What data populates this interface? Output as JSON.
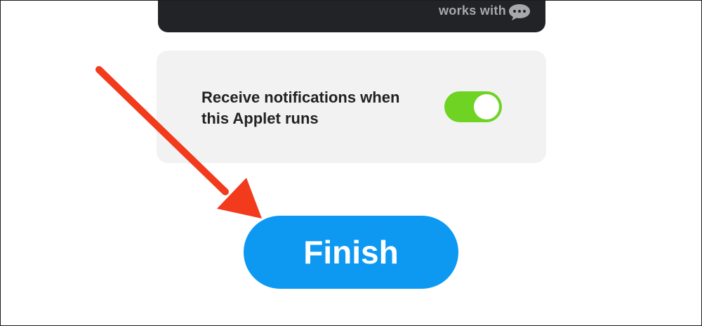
{
  "top_card": {
    "works_with_text": "works with",
    "icon": "chat-bubble-icon"
  },
  "notifications": {
    "label": "Receive notifications when this Applet runs",
    "toggle_on": true
  },
  "finish_button": {
    "label": "Finish"
  },
  "annotation": {
    "icon": "red-arrow-icon",
    "color": "#f23a1d"
  },
  "colors": {
    "toggle_on": "#6fd323",
    "button": "#0d99f2",
    "dark_card": "#222326",
    "settings_card": "#f2f2f2"
  }
}
